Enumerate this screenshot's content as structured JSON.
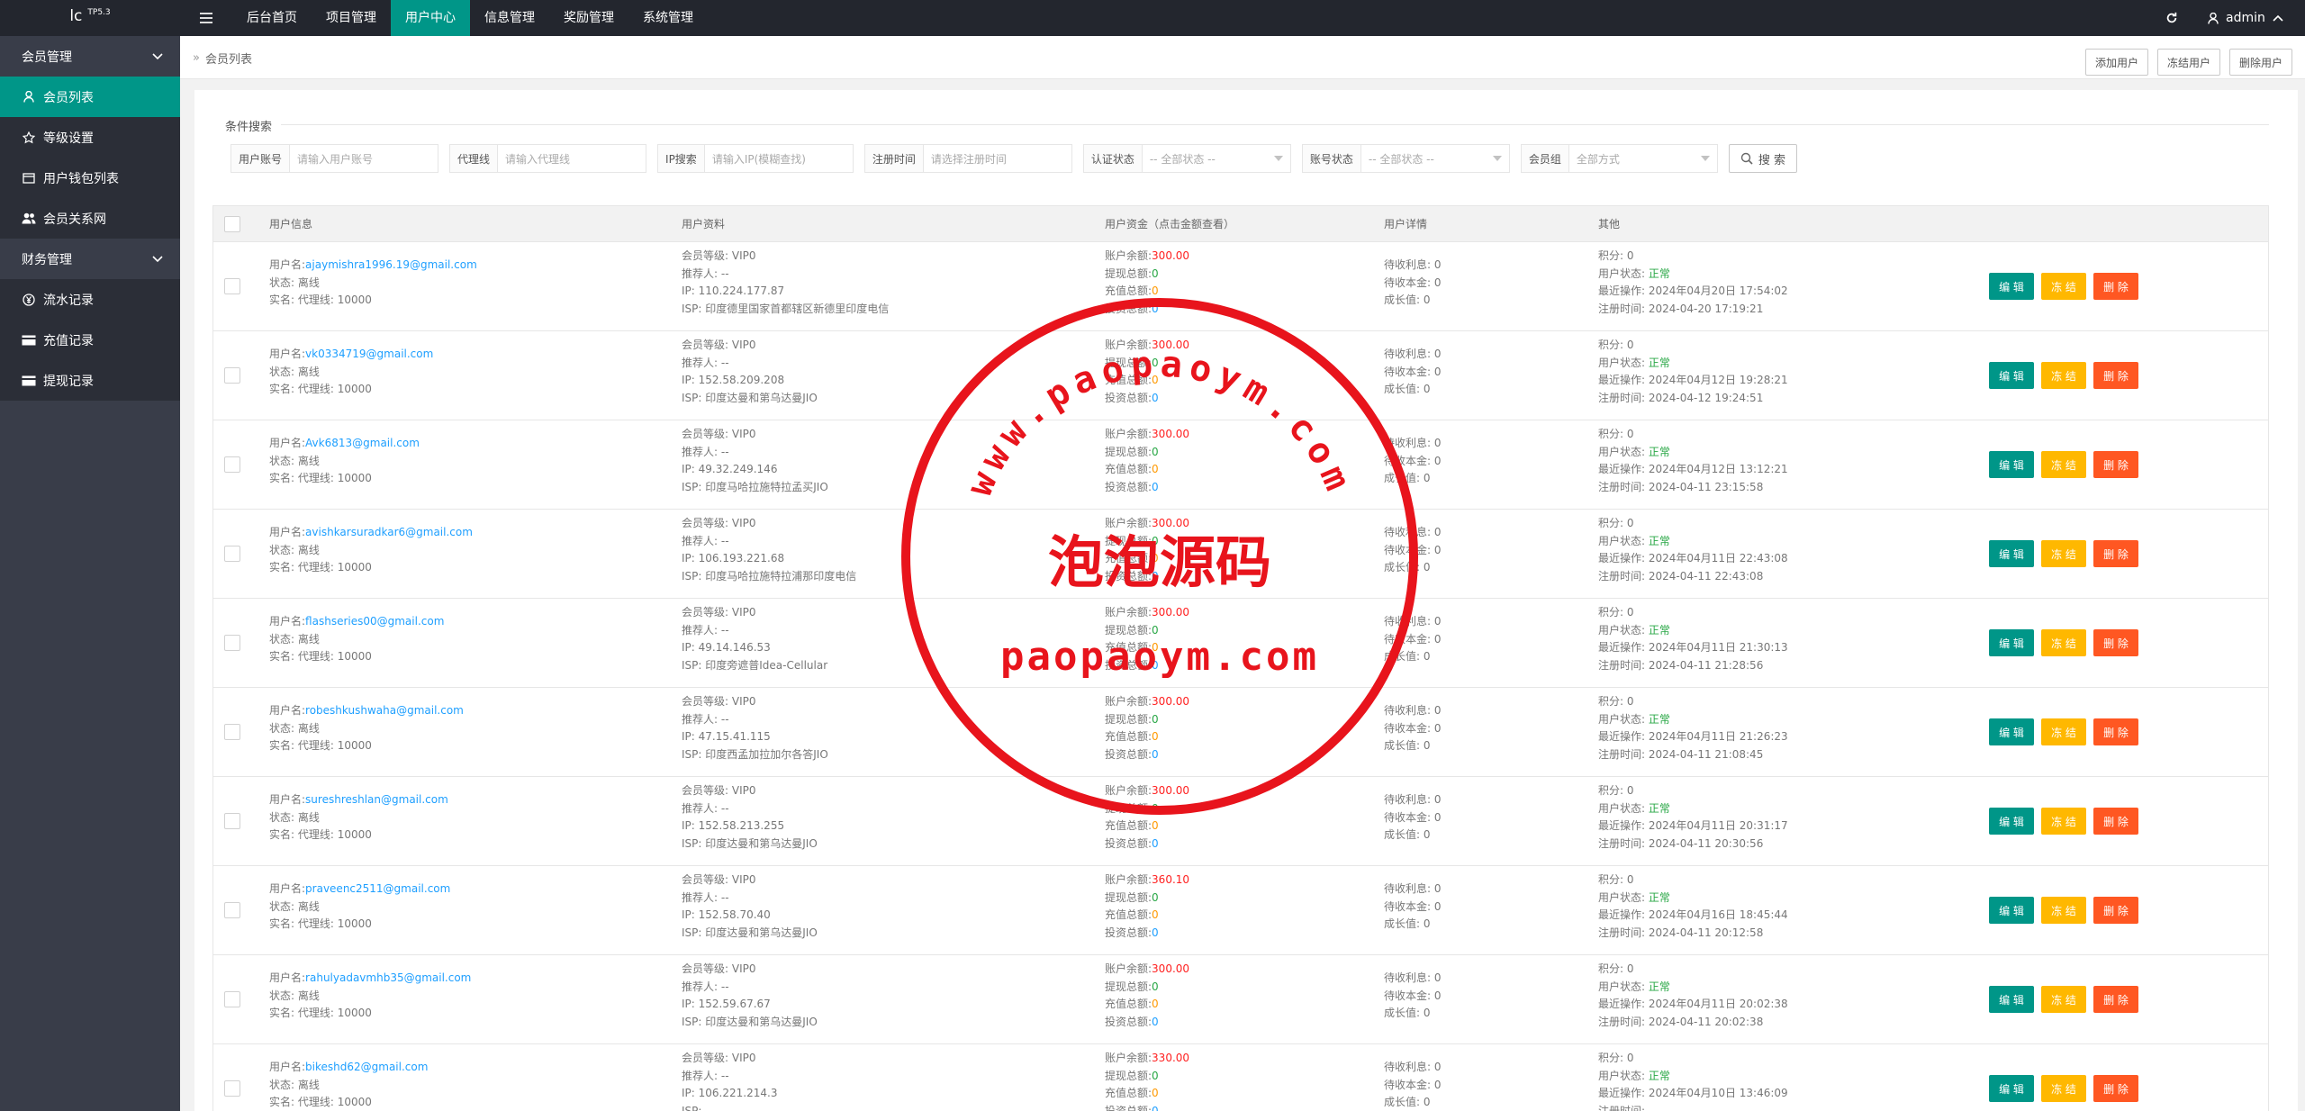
{
  "app": {
    "logo": "lc",
    "logo_sup": "TP5.3"
  },
  "topnav": {
    "items": [
      {
        "label": "后台首页"
      },
      {
        "label": "项目管理"
      },
      {
        "label": "用户中心"
      },
      {
        "label": "信息管理"
      },
      {
        "label": "奖励管理"
      },
      {
        "label": "系统管理"
      }
    ],
    "active": "用户中心",
    "user": "admin"
  },
  "sidebar": {
    "groups": [
      {
        "label": "会员管理",
        "items": [
          {
            "label": "会员列表",
            "icon": "user-icon"
          },
          {
            "label": "等级设置",
            "icon": "star-icon"
          },
          {
            "label": "用户钱包列表",
            "icon": "wallet-icon"
          },
          {
            "label": "会员关系网",
            "icon": "users-icon"
          }
        ]
      },
      {
        "label": "财务管理",
        "items": [
          {
            "label": "流水记录",
            "icon": "yen-icon"
          },
          {
            "label": "充值记录",
            "icon": "card-icon"
          },
          {
            "label": "提现记录",
            "icon": "card-icon"
          }
        ]
      }
    ]
  },
  "breadcrumb": {
    "sep": "»",
    "current": "会员列表"
  },
  "top_actions": {
    "add": "添加用户",
    "freeze": "冻结用户",
    "delete": "删除用户"
  },
  "filters": {
    "legend": "条件搜索",
    "account_label": "用户账号",
    "account_placeholder": "请输入用户账号",
    "agent_label": "代理线",
    "agent_placeholder": "请输入代理线",
    "ip_label": "IP搜索",
    "ip_placeholder": "请输入IP(模糊查找)",
    "regtime_label": "注册时间",
    "regtime_placeholder": "请选择注册时间",
    "auth_label": "认证状态",
    "auth_value": "-- 全部状态 --",
    "acct_status_label": "账号状态",
    "acct_status_value": "-- 全部状态 --",
    "group_label": "会员组",
    "group_value": "全部方式",
    "search_button": "搜 索"
  },
  "table": {
    "headers": {
      "info": "用户信息",
      "profile": "用户资料",
      "funds": "用户资金（点击金额查看）",
      "details": "用户详情",
      "other": "其他"
    },
    "labels": {
      "username": "用户名:",
      "state": "状态:",
      "realname": "实名:",
      "agentline": "代理线:",
      "level": "会员等级:",
      "referrer": "推荐人:",
      "ip": "IP:",
      "isp": "ISP:",
      "balance": "账户余额:",
      "withdraw": "提现总额:",
      "recharge": "充值总额:",
      "invest": "投资总额:",
      "pending_interest": "待收利息:",
      "pending_principal": "待收本金:",
      "growth": "成长值:",
      "points": "积分:",
      "user_status": "用户状态:",
      "last_op": "最近操作:",
      "reg_time": "注册时间:"
    },
    "actions": {
      "edit": "编 辑",
      "freeze": "冻 结",
      "delete": "删 除"
    },
    "rows": [
      {
        "email": "ajaymishra1996.19@gmail.com",
        "state": "离线",
        "agent": "10000",
        "level": "VIP0",
        "referrer": "--",
        "ip": "110.224.177.87",
        "isp": "印度德里国家首都辖区新德里印度电信",
        "balance": "300.00",
        "withdraw": "0",
        "recharge": "0",
        "invest": "0",
        "interest": "0",
        "principal": "0",
        "growth": "0",
        "points": "0",
        "status": "正常",
        "last_op": "2024年04月20日 17:54:02",
        "reg_time": "2024-04-20 17:19:21"
      },
      {
        "email": "vk0334719@gmail.com",
        "state": "离线",
        "agent": "10000",
        "level": "VIP0",
        "referrer": "--",
        "ip": "152.58.209.208",
        "isp": "印度达曼和第乌达曼JIO",
        "balance": "300.00",
        "withdraw": "0",
        "recharge": "0",
        "invest": "0",
        "interest": "0",
        "principal": "0",
        "growth": "0",
        "points": "0",
        "status": "正常",
        "last_op": "2024年04月12日 19:28:21",
        "reg_time": "2024-04-12 19:24:51"
      },
      {
        "email": "Avk6813@gmail.com",
        "state": "离线",
        "agent": "10000",
        "level": "VIP0",
        "referrer": "--",
        "ip": "49.32.249.146",
        "isp": "印度马哈拉施特拉孟买JIO",
        "balance": "300.00",
        "withdraw": "0",
        "recharge": "0",
        "invest": "0",
        "interest": "0",
        "principal": "0",
        "growth": "0",
        "points": "0",
        "status": "正常",
        "last_op": "2024年04月12日 13:12:21",
        "reg_time": "2024-04-11 23:15:58"
      },
      {
        "email": "avishkarsuradkar6@gmail.com",
        "state": "离线",
        "agent": "10000",
        "level": "VIP0",
        "referrer": "--",
        "ip": "106.193.221.68",
        "isp": "印度马哈拉施特拉浦那印度电信",
        "balance": "300.00",
        "withdraw": "0",
        "recharge": "0",
        "invest": "0",
        "interest": "0",
        "principal": "0",
        "growth": "0",
        "points": "0",
        "status": "正常",
        "last_op": "2024年04月11日 22:43:08",
        "reg_time": "2024-04-11 22:43:08"
      },
      {
        "email": "flashseries00@gmail.com",
        "state": "离线",
        "agent": "10000",
        "level": "VIP0",
        "referrer": "--",
        "ip": "49.14.146.53",
        "isp": "印度旁遮普Idea-Cellular",
        "balance": "300.00",
        "withdraw": "0",
        "recharge": "0",
        "invest": "0",
        "interest": "0",
        "principal": "0",
        "growth": "0",
        "points": "0",
        "status": "正常",
        "last_op": "2024年04月11日 21:30:13",
        "reg_time": "2024-04-11 21:28:56"
      },
      {
        "email": "robeshkushwaha@gmail.com",
        "state": "离线",
        "agent": "10000",
        "level": "VIP0",
        "referrer": "--",
        "ip": "47.15.41.115",
        "isp": "印度西孟加拉加尔各答JIO",
        "balance": "300.00",
        "withdraw": "0",
        "recharge": "0",
        "invest": "0",
        "interest": "0",
        "principal": "0",
        "growth": "0",
        "points": "0",
        "status": "正常",
        "last_op": "2024年04月11日 21:26:23",
        "reg_time": "2024-04-11 21:08:45"
      },
      {
        "email": "sureshreshlan@gmail.com",
        "state": "离线",
        "agent": "10000",
        "level": "VIP0",
        "referrer": "--",
        "ip": "152.58.213.255",
        "isp": "印度达曼和第乌达曼JIO",
        "balance": "300.00",
        "withdraw": "0",
        "recharge": "0",
        "invest": "0",
        "interest": "0",
        "principal": "0",
        "growth": "0",
        "points": "0",
        "status": "正常",
        "last_op": "2024年04月11日 20:31:17",
        "reg_time": "2024-04-11 20:30:56"
      },
      {
        "email": "praveenc2511@gmail.com",
        "state": "离线",
        "agent": "10000",
        "level": "VIP0",
        "referrer": "--",
        "ip": "152.58.70.40",
        "isp": "印度达曼和第乌达曼JIO",
        "balance": "360.10",
        "withdraw": "0",
        "recharge": "0",
        "invest": "0",
        "interest": "0",
        "principal": "0",
        "growth": "0",
        "points": "0",
        "status": "正常",
        "last_op": "2024年04月16日 18:45:44",
        "reg_time": "2024-04-11 20:12:58"
      },
      {
        "email": "rahulyadavmhb35@gmail.com",
        "state": "离线",
        "agent": "10000",
        "level": "VIP0",
        "referrer": "--",
        "ip": "152.59.67.67",
        "isp": "印度达曼和第乌达曼JIO",
        "balance": "300.00",
        "withdraw": "0",
        "recharge": "0",
        "invest": "0",
        "interest": "0",
        "principal": "0",
        "growth": "0",
        "points": "0",
        "status": "正常",
        "last_op": "2024年04月11日 20:02:38",
        "reg_time": "2024-04-11 20:02:38"
      },
      {
        "email": "bikeshd62@gmail.com",
        "state": "离线",
        "agent": "10000",
        "level": "VIP0",
        "referrer": "--",
        "ip": "106.221.214.3",
        "isp": "",
        "balance": "330.00",
        "withdraw": "0",
        "recharge": "0",
        "invest": "0",
        "interest": "0",
        "principal": "0",
        "growth": "0",
        "points": "0",
        "status": "正常",
        "last_op": "2024年04月10日 13:46:09",
        "reg_time": ""
      }
    ]
  },
  "watermark": {
    "arc_text": "www.paopaoym.com",
    "center_text": "泡泡源码",
    "bottom_text": "paopaoym.com"
  },
  "colors": {
    "accent": "#009688",
    "topbar": "#23262e",
    "sidebar": "#393d49",
    "freeze": "#ffb800",
    "delete": "#ff5722",
    "link": "#1e9fff",
    "stamp": "#e8141c"
  }
}
